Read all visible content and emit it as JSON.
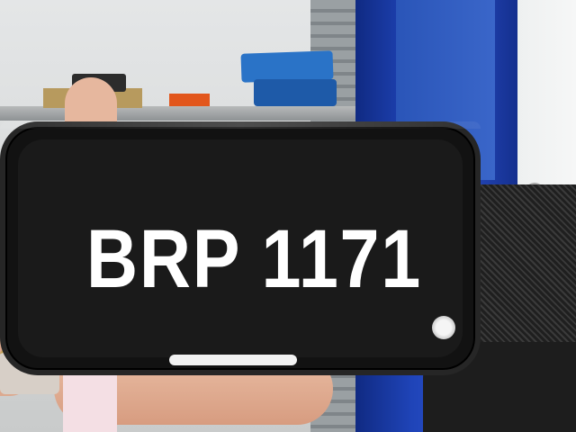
{
  "photo": {
    "phone_screen": {
      "plate_number": "BRP 1171"
    }
  },
  "colors": {
    "screen_background": "#1a1a1a",
    "plate_text": "#ffffff",
    "cabinet_blue": "#1f44b8"
  },
  "icons": [
    "assistive-touch-icon",
    "home-indicator-bar"
  ]
}
